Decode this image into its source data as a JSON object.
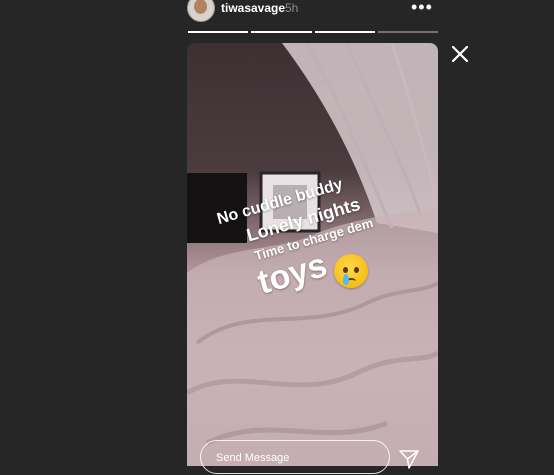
{
  "header": {
    "username": "tiwasavage",
    "time_ago": "5h",
    "more_icon": "more-horizontal-icon",
    "close_icon": "close-icon"
  },
  "progress": {
    "segments": 4,
    "completed": 3
  },
  "story": {
    "caption_lines": [
      "No cuddle buddy",
      "Lonely nights",
      "Time to charge dem",
      "toys"
    ],
    "sticker": "crying-face-emoji"
  },
  "reply": {
    "placeholder": "Send Message",
    "send_icon": "send-icon"
  }
}
